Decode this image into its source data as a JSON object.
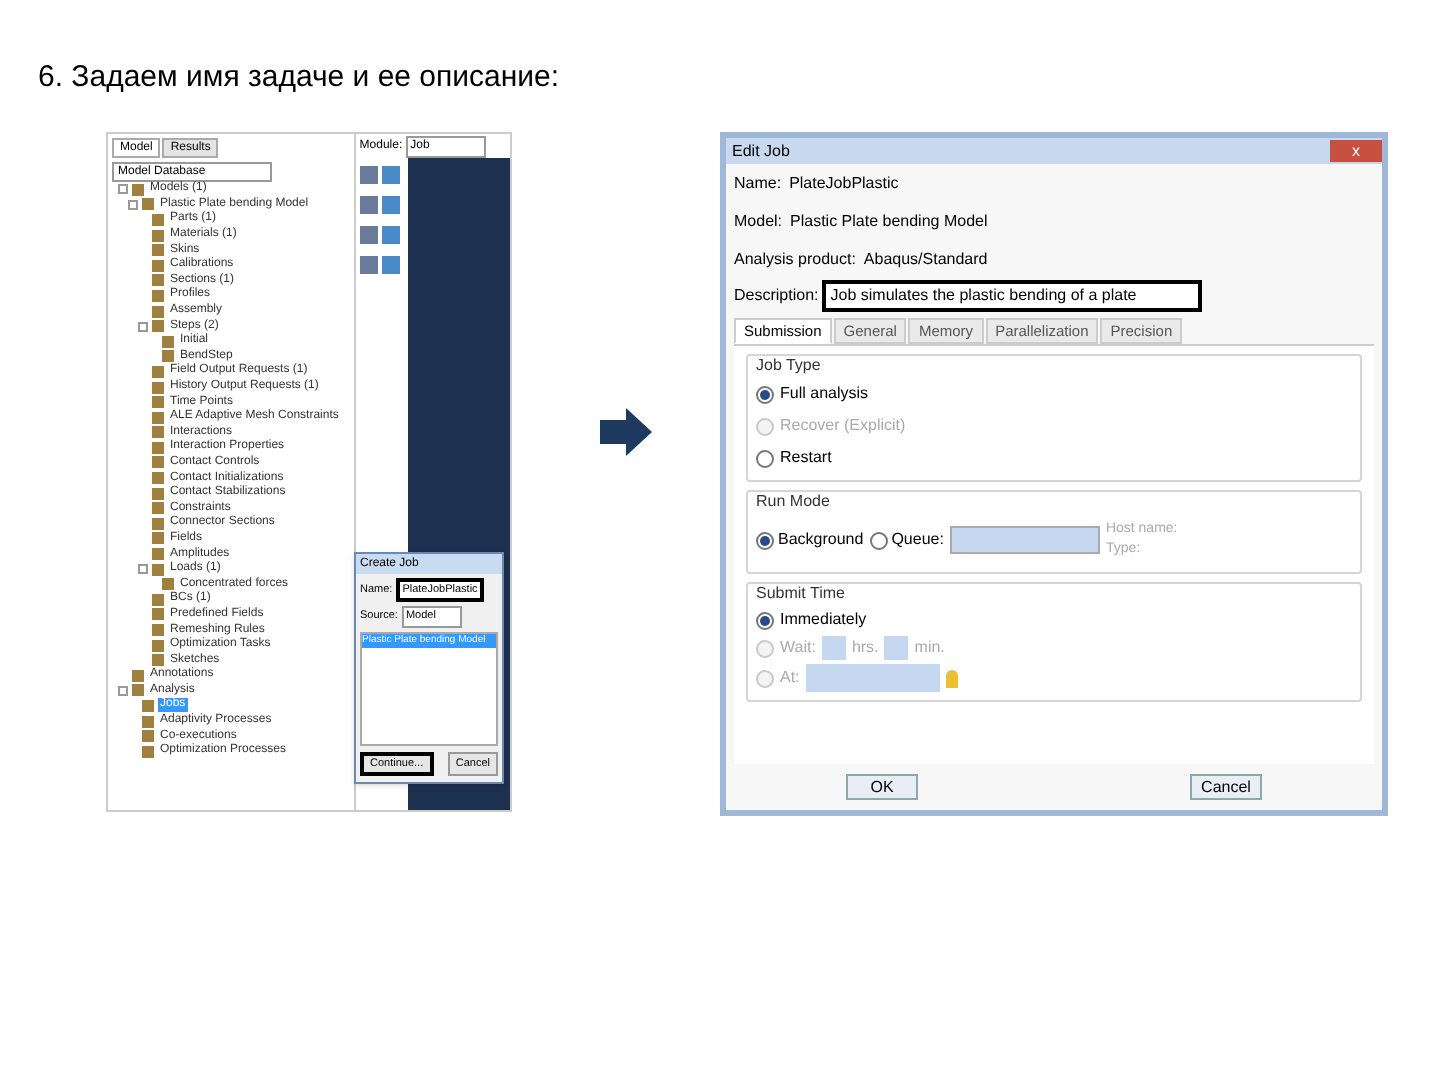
{
  "slide_title": "6. Задаем имя задаче и ее описание:",
  "model_tree": {
    "tabs": [
      {
        "label": "Model",
        "selected": true
      },
      {
        "label": "Results",
        "selected": false
      }
    ],
    "database": "Model Database",
    "items": [
      {
        "label": "Models (1)",
        "selected": false,
        "children": [
          {
            "label": "Plastic Plate bending Model",
            "selected": false,
            "children": [
              {
                "label": "Parts (1)",
                "selected": false
              },
              {
                "label": "Materials (1)",
                "selected": false
              },
              {
                "label": "Skins",
                "selected": false
              },
              {
                "label": "Calibrations",
                "selected": false
              },
              {
                "label": "Sections (1)",
                "selected": false
              },
              {
                "label": "Profiles",
                "selected": false
              },
              {
                "label": "Assembly",
                "selected": false
              },
              {
                "label": "Steps (2)",
                "selected": false,
                "children": [
                  {
                    "label": "Initial",
                    "selected": false
                  },
                  {
                    "label": "BendStep",
                    "selected": false
                  }
                ]
              },
              {
                "label": "Field Output Requests (1)",
                "selected": false
              },
              {
                "label": "History Output Requests (1)",
                "selected": false
              },
              {
                "label": "Time Points",
                "selected": false
              },
              {
                "label": "ALE Adaptive Mesh Constraints",
                "selected": false
              },
              {
                "label": "Interactions",
                "selected": false
              },
              {
                "label": "Interaction Properties",
                "selected": false
              },
              {
                "label": "Contact Controls",
                "selected": false
              },
              {
                "label": "Contact Initializations",
                "selected": false
              },
              {
                "label": "Contact Stabilizations",
                "selected": false
              },
              {
                "label": "Constraints",
                "selected": false
              },
              {
                "label": "Connector Sections",
                "selected": false
              },
              {
                "label": "Fields",
                "selected": false
              },
              {
                "label": "Amplitudes",
                "selected": false
              },
              {
                "label": "Loads (1)",
                "selected": false,
                "children": [
                  {
                    "label": "Concentrated forces",
                    "selected": false
                  }
                ]
              },
              {
                "label": "BCs (1)",
                "selected": false
              },
              {
                "label": "Predefined Fields",
                "selected": false
              },
              {
                "label": "Remeshing Rules",
                "selected": false
              },
              {
                "label": "Optimization Tasks",
                "selected": false
              },
              {
                "label": "Sketches",
                "selected": false
              }
            ]
          }
        ]
      },
      {
        "label": "Annotations",
        "selected": false
      },
      {
        "label": "Analysis",
        "selected": false,
        "children": [
          {
            "label": "Jobs",
            "selected": true
          },
          {
            "label": "Adaptivity Processes",
            "selected": false
          },
          {
            "label": "Co-executions",
            "selected": false
          },
          {
            "label": "Optimization Processes",
            "selected": false
          }
        ]
      }
    ]
  },
  "module": {
    "label": "Module:",
    "value": "Job"
  },
  "create_job": {
    "title": "Create Job",
    "name_label": "Name:",
    "name_value": "PlateJobPlastic",
    "source_label": "Source:",
    "source_value": "Model",
    "models": [
      {
        "label": "Plastic Plate bending Model",
        "selected": true
      }
    ],
    "buttons": [
      "Continue...",
      "Cancel"
    ]
  },
  "edit_job": {
    "title": "Edit Job",
    "close": "x",
    "info": [
      {
        "label": "Name:",
        "value": "PlateJobPlastic"
      },
      {
        "label": "Model:",
        "value": "Plastic Plate bending Model"
      },
      {
        "label": "Analysis product:",
        "value": "Abaqus/Standard"
      }
    ],
    "description_label": "Description:",
    "description_value": "Job simulates the plastic bending of a plate",
    "tabs": [
      {
        "label": "Submission",
        "selected": true
      },
      {
        "label": "General",
        "selected": false
      },
      {
        "label": "Memory",
        "selected": false
      },
      {
        "label": "Parallelization",
        "selected": false
      },
      {
        "label": "Precision",
        "selected": false
      }
    ],
    "job_type": {
      "title": "Job Type",
      "options": [
        {
          "label": "Full analysis",
          "selected": true,
          "disabled": false
        },
        {
          "label": "Recover (Explicit)",
          "selected": false,
          "disabled": true
        },
        {
          "label": "Restart",
          "selected": false,
          "disabled": false
        }
      ]
    },
    "run_mode": {
      "title": "Run Mode",
      "options": [
        {
          "label": "Background",
          "selected": true
        },
        {
          "label": "Queue:",
          "selected": false
        }
      ],
      "host_label": "Host name:",
      "type_label": "Type:"
    },
    "submit_time": {
      "title": "Submit Time",
      "immediately": {
        "label": "Immediately",
        "selected": true
      },
      "wait": {
        "label": "Wait:",
        "selected": false,
        "hrs": "hrs.",
        "min": "min."
      },
      "at": {
        "label": "At:",
        "selected": false
      }
    },
    "buttons": [
      "OK",
      "Cancel"
    ]
  }
}
